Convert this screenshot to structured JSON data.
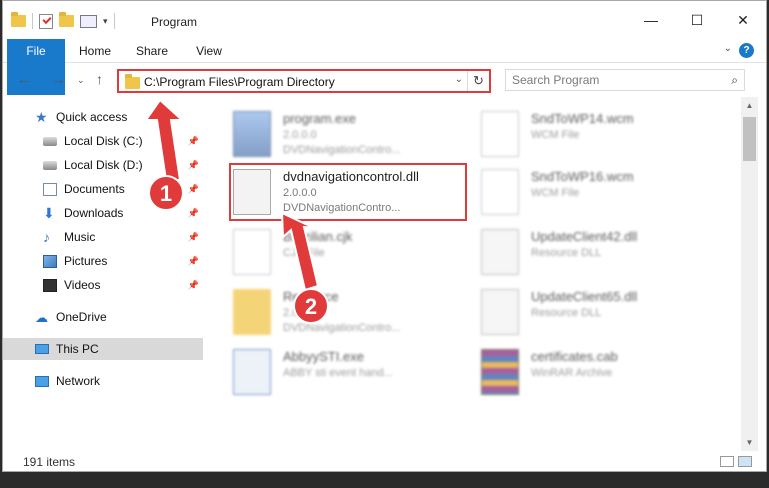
{
  "window": {
    "title": "Program",
    "controls": {
      "minimize": "—",
      "maximize": "☐",
      "close": "✕"
    }
  },
  "ribbon": {
    "tabs": [
      "File",
      "Home",
      "Share",
      "View"
    ],
    "help": "?"
  },
  "nav": {
    "address_path": "C:\\Program Files\\Program Directory",
    "search_placeholder": "Search Program"
  },
  "sidebar": {
    "items": [
      {
        "label": "Quick access",
        "icon": "star-icon",
        "pinned": false
      },
      {
        "label": "Local Disk (C:)",
        "icon": "drive-icon",
        "pinned": true
      },
      {
        "label": "Local Disk (D:)",
        "icon": "drive-icon",
        "pinned": true
      },
      {
        "label": "Documents",
        "icon": "documents-icon",
        "pinned": true
      },
      {
        "label": "Downloads",
        "icon": "downloads-icon",
        "pinned": true
      },
      {
        "label": "Music",
        "icon": "music-icon",
        "pinned": true
      },
      {
        "label": "Pictures",
        "icon": "pictures-icon",
        "pinned": true
      },
      {
        "label": "Videos",
        "icon": "videos-icon",
        "pinned": true
      },
      {
        "label": "OneDrive",
        "icon": "onedrive-icon",
        "pinned": false
      },
      {
        "label": "This PC",
        "icon": "this-pc-icon",
        "pinned": false,
        "selected": true
      },
      {
        "label": "Network",
        "icon": "network-icon",
        "pinned": false
      }
    ]
  },
  "files": [
    {
      "name": "program.exe",
      "line2": "2.0.0.0",
      "line3": "DVDNavigationContro...",
      "icon": "exe-icon",
      "blurred": true
    },
    {
      "name": "SndToWP14.wcm",
      "line2": "WCM File",
      "line3": "",
      "icon": "document-icon",
      "blurred": true
    },
    {
      "name": "dvdnavigationcontrol.dll",
      "line2": "2.0.0.0",
      "line3": "DVDNavigationContro...",
      "icon": "dll-gear-icon",
      "blurred": false
    },
    {
      "name": "SndToWP16.wcm",
      "line2": "WCM File",
      "line3": "",
      "icon": "document-icon",
      "blurred": true
    },
    {
      "name": "Brazilian.cjk",
      "line2": "CJK File",
      "line3": "",
      "icon": "document-icon",
      "blurred": true
    },
    {
      "name": "UpdateClient42.dll",
      "line2": "Resource DLL",
      "line3": "",
      "icon": "dll-gear-icon",
      "blurred": true
    },
    {
      "name": "Resource",
      "line2": "2.0.0.0",
      "line3": "DVDNavigationContro...",
      "icon": "folder-icon",
      "blurred": true
    },
    {
      "name": "UpdateClient65.dll",
      "line2": "Resource DLL",
      "line3": "",
      "icon": "dll-gear-icon",
      "blurred": true
    },
    {
      "name": "AbbyySTI.exe",
      "line2": "ABBY sti event hand...",
      "line3": "",
      "icon": "app-icon",
      "blurred": true
    },
    {
      "name": "certificates.cab",
      "line2": "WinRAR Archive",
      "line3": "",
      "icon": "winrar-icon",
      "blurred": true
    }
  ],
  "status": {
    "item_count": "191 items"
  },
  "annotations": [
    {
      "number": "1",
      "target": "address-bar"
    },
    {
      "number": "2",
      "target": "dvdnavigationcontrol.dll"
    }
  ],
  "colors": {
    "accent": "#1979ca",
    "highlight": "#e03a3a",
    "selected": "#d9d9d9"
  }
}
